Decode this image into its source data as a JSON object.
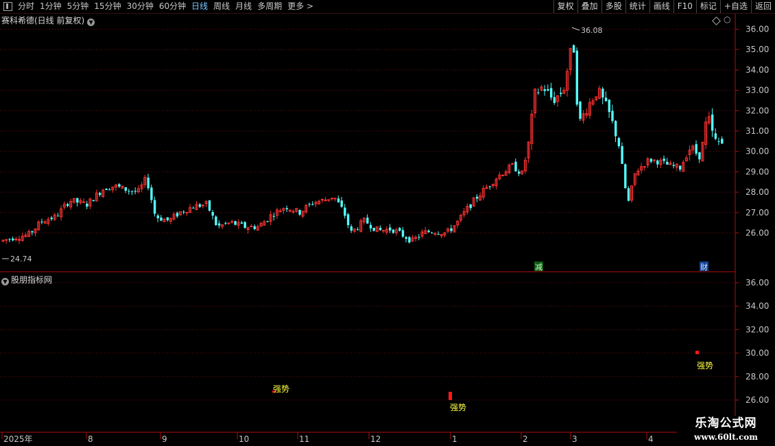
{
  "toolbar": {
    "periods": [
      "分时",
      "1分钟",
      "5分钟",
      "15分钟",
      "30分钟",
      "60分钟",
      "日线",
      "周线",
      "月线",
      "多周期",
      "更多 >"
    ],
    "active": "日线",
    "buttons": [
      "复权",
      "叠加",
      "多股",
      "统计",
      "画线",
      "F10",
      "标记",
      "+自选",
      "返回"
    ]
  },
  "main": {
    "title": "赛科希德(日线 前复权)",
    "high_label": "36.08",
    "low_label": "24.74",
    "badge_1": "减",
    "badge_2": "财",
    "y_ticks": [
      "36.00",
      "35.00",
      "34.00",
      "33.00",
      "32.00",
      "31.00",
      "30.00",
      "29.00",
      "28.00",
      "27.00",
      "26.00"
    ]
  },
  "sub": {
    "title": "股朋指标网",
    "signal_label": "强势",
    "y_ticks": [
      "36.00",
      "34.00",
      "32.00",
      "30.00",
      "28.00",
      "26.00"
    ]
  },
  "xaxis": {
    "labels": [
      "2025年",
      "8",
      "9",
      "10",
      "11",
      "12",
      "1",
      "2",
      "3",
      "4"
    ]
  },
  "watermark": {
    "line1": "乐淘公式网",
    "line2": "www.60lt.com"
  },
  "colors": {
    "up": "#ff3232",
    "down": "#54ffff",
    "grid": "#7a1010",
    "axis": "#b01010"
  }
}
